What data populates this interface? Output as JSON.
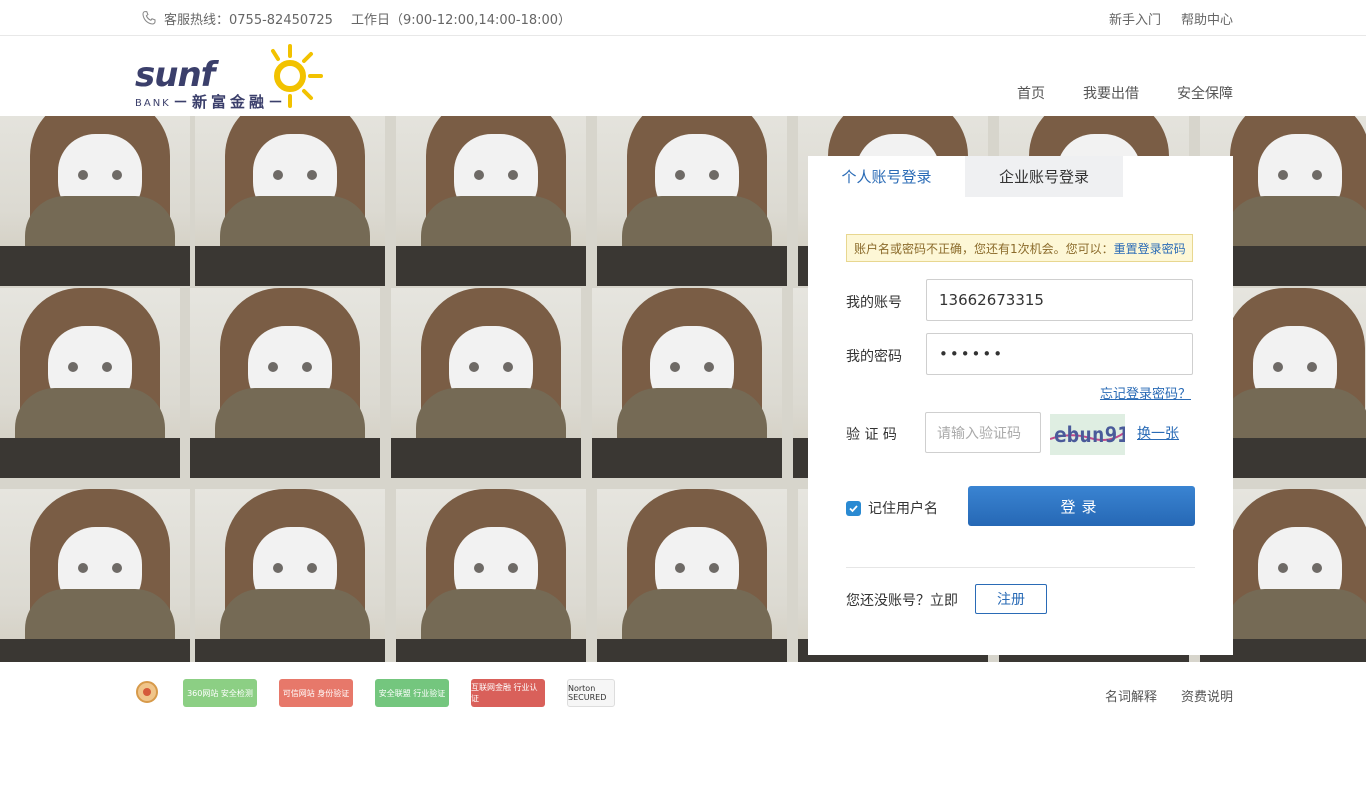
{
  "topbar": {
    "hotline": "客服热线：0755-82450725",
    "hours": "工作日（9:00-12:00,14:00-18:00）",
    "links": [
      "新手入门",
      "帮助中心"
    ]
  },
  "header": {
    "logo_text": "SUNFO",
    "logo_sub": "BANK－新富金融－",
    "nav": [
      "首页",
      "我要出借",
      "安全保障"
    ]
  },
  "login": {
    "tabs": [
      "个人账号登录",
      "企业账号登录"
    ],
    "warning_text": "账户名或密码不正确，您还有1次机会。您可以：",
    "warning_link": "重置登录密码",
    "account_label": "我的账号",
    "account_value": "13662673315",
    "password_label": "我的密码",
    "password_value": "••••••",
    "forgot_label": "忘记登录密码？",
    "captcha_label": "验 证 码",
    "captcha_placeholder": "请输入验证码",
    "captcha_text": "ebun91",
    "swap_label": "换一张",
    "remember_label": "记住用户名",
    "login_button": "登录",
    "no_account_text": "您还没账号？立即",
    "register_button": "注册"
  },
  "footer": {
    "badges": [
      {
        "name": "police",
        "label": "",
        "color": "#e8b26a"
      },
      {
        "name": "360",
        "label": "360网站 安全检测",
        "color": "#7ec77a"
      },
      {
        "name": "credible",
        "label": "可信网站 身份验证",
        "color": "#e86a5a"
      },
      {
        "name": "alliance",
        "label": "安全联盟 行业验证",
        "color": "#6cc07a"
      },
      {
        "name": "finance",
        "label": "互联网金融 行业认证",
        "color": "#d9534f"
      },
      {
        "name": "norton",
        "label": "Norton SECURED",
        "color": "#f4f4f4"
      }
    ],
    "links": [
      "名词解释",
      "资费说明"
    ]
  },
  "colors": {
    "accent": "#2a6bb6",
    "logo_yellow": "#f2c200",
    "logo_navy": "#3b3f6b"
  }
}
